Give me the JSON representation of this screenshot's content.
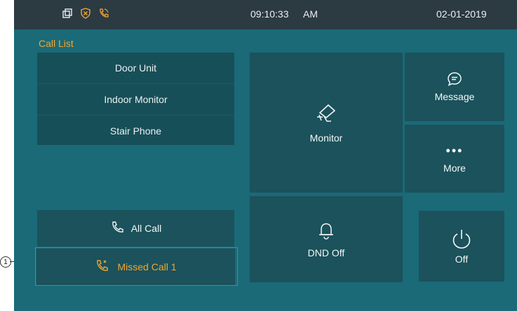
{
  "statusbar": {
    "icons": [
      "window-icon",
      "shield-x-icon",
      "phone-call-icon"
    ],
    "time": "09:10:33",
    "ampm": "AM",
    "date": "02-01-2019"
  },
  "call_list": {
    "title": "Call List",
    "items": [
      "Door Unit",
      "Indoor Monitor",
      "Stair Phone"
    ]
  },
  "actions": {
    "monitor": "Monitor",
    "message": "Message",
    "more_dots": "•••",
    "more": "More",
    "dnd": "DND Off",
    "off": "Off"
  },
  "calls": {
    "all_call": "All Call",
    "missed_call": "Missed Call 1"
  },
  "annotation": {
    "callout_number": "1"
  },
  "colors": {
    "background": "#1a6a78",
    "statusbar": "#2c3a42",
    "tile": "#1b525b",
    "accent": "#f2a531",
    "text": "#f4f7f8"
  }
}
